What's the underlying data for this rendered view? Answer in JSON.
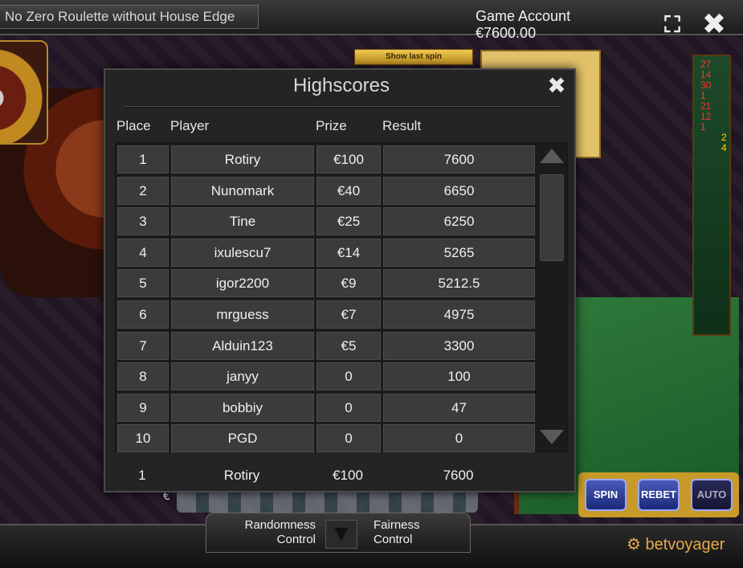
{
  "window": {
    "title": "No Zero Roulette without House Edge",
    "account": "Game Account €7600.00",
    "fullscreen_icon": "fullscreen-icon",
    "close_icon": "close-icon"
  },
  "game": {
    "show_last_spin_label": "Show last spin",
    "last_number": "27",
    "history": [
      "27",
      "14",
      "30",
      "1",
      "21",
      "12",
      "1"
    ],
    "history_right": [
      "2",
      "4"
    ],
    "chip_currency": "€",
    "actions": [
      "SPIN",
      "REBET",
      "AUTO"
    ]
  },
  "highscores": {
    "title": "Highscores",
    "close_icon": "close-icon",
    "columns": {
      "place": "Place",
      "player": "Player",
      "prize": "Prize",
      "result": "Result"
    },
    "rows": [
      {
        "place": "1",
        "player": "Rotiry",
        "prize": "€100",
        "result": "7600"
      },
      {
        "place": "2",
        "player": "Nunomark",
        "prize": "€40",
        "result": "6650"
      },
      {
        "place": "3",
        "player": "Tine",
        "prize": "€25",
        "result": "6250"
      },
      {
        "place": "4",
        "player": "ixulescu7",
        "prize": "€14",
        "result": "5265"
      },
      {
        "place": "5",
        "player": "igor2200",
        "prize": "€9",
        "result": "5212.5"
      },
      {
        "place": "6",
        "player": "mrguess",
        "prize": "€7",
        "result": "4975"
      },
      {
        "place": "7",
        "player": "Alduin123",
        "prize": "€5",
        "result": "3300"
      },
      {
        "place": "8",
        "player": "janyy",
        "prize": "0",
        "result": "100"
      },
      {
        "place": "9",
        "player": "bobbiy",
        "prize": "0",
        "result": "47"
      },
      {
        "place": "10",
        "player": "PGD",
        "prize": "0",
        "result": "0"
      }
    ],
    "my_entry": {
      "place": "1",
      "player": "Rotiry",
      "prize": "€100",
      "result": "7600"
    }
  },
  "footer": {
    "randomness_line1": "Randomness",
    "randomness_line2": "Control",
    "fairness_line1": "Fairness",
    "fairness_line2": "Control",
    "brand": "betvoyager"
  },
  "colors": {
    "modal_bg": "#242424",
    "cell_bg": "#3b3b3b",
    "felt": "#2f7a3b",
    "gold": "#e2c16a"
  }
}
